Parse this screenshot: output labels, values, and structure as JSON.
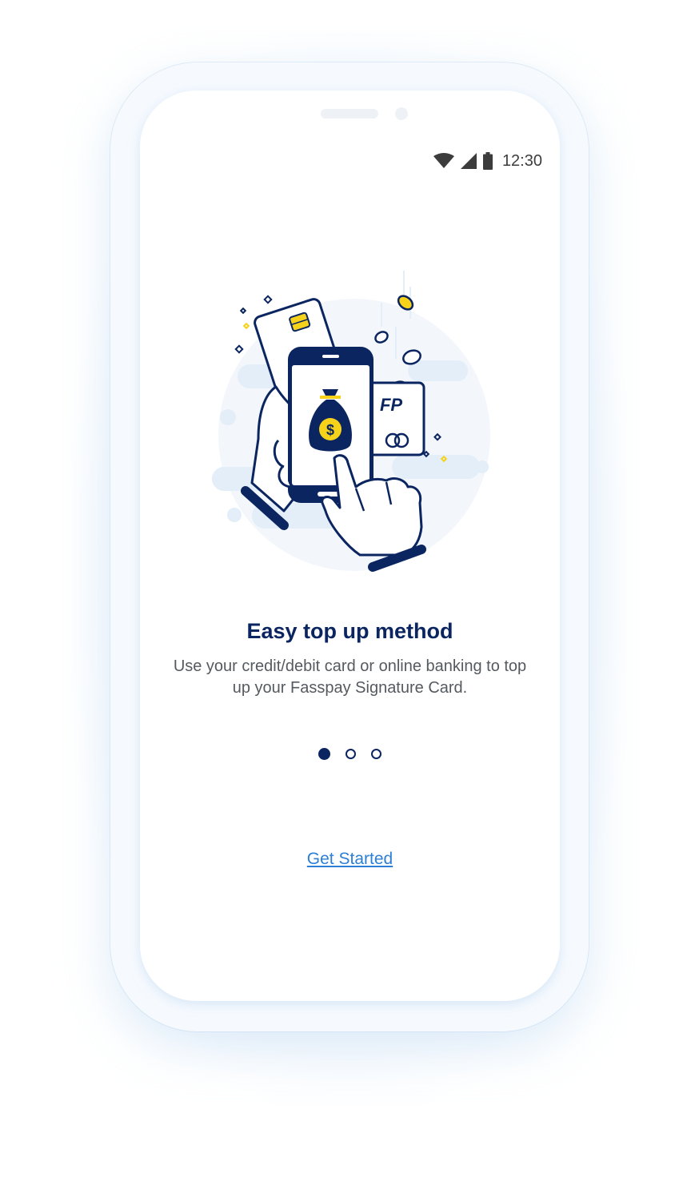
{
  "status_bar": {
    "time": "12:30",
    "icons": [
      "wifi-icon",
      "cellular-signal-icon",
      "battery-icon"
    ]
  },
  "illustration": {
    "subject": "hand-holding-phone-with-money-bag-icon",
    "card_logo": "FP"
  },
  "onboarding": {
    "title": "Easy top up method",
    "description": "Use your credit/debit card or online banking to top up your Fasspay Signature Card.",
    "pages": 3,
    "active_page": 1
  },
  "cta": {
    "label": "Get Started"
  },
  "colors": {
    "navy": "#0b2560",
    "accent_yellow": "#f7d21b",
    "link_blue": "#2d7fd6",
    "light_blue": "#e3eef9",
    "text_gray": "#555a60"
  }
}
